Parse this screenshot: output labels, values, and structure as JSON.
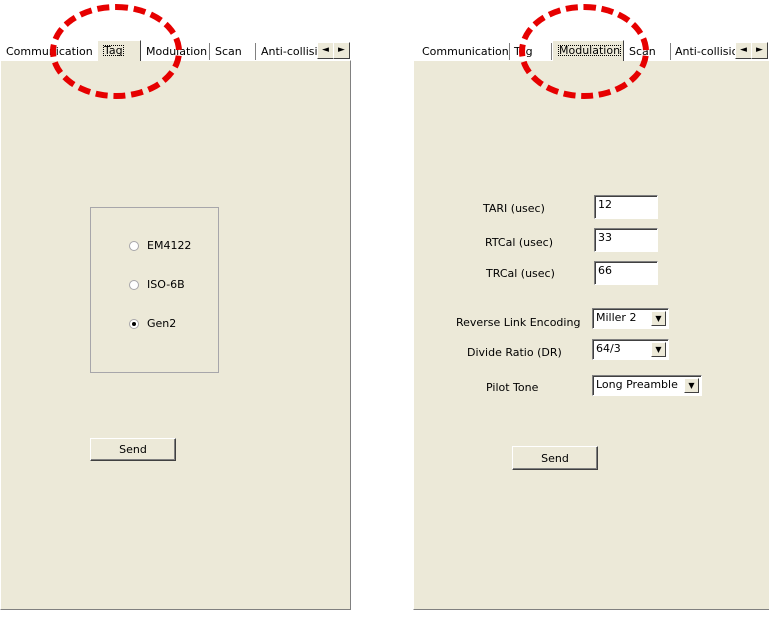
{
  "left": {
    "tabs": [
      "Communication",
      "Tag",
      "Modulation",
      "Scan",
      "Anti-collisio"
    ],
    "active_tab": "Tag",
    "scroll_left": "◄",
    "scroll_right": "►",
    "radios": [
      {
        "label": "EM4122",
        "checked": false
      },
      {
        "label": "ISO-6B",
        "checked": false
      },
      {
        "label": "Gen2",
        "checked": true
      }
    ],
    "send_label": "Send"
  },
  "right": {
    "tabs": [
      "Communication",
      "Tag",
      "Modulation",
      "Scan",
      "Anti-collisio"
    ],
    "active_tab": "Modulation",
    "scroll_left": "◄",
    "scroll_right": "►",
    "fields": [
      {
        "label": "TARI (usec)",
        "value": "12"
      },
      {
        "label": "RTCal (usec)",
        "value": "33"
      },
      {
        "label": "TRCal (usec)",
        "value": "66"
      }
    ],
    "dropdowns": [
      {
        "label": "Reverse Link Encoding",
        "value": "Miller 2"
      },
      {
        "label": "Divide Ratio (DR)",
        "value": "64/3"
      },
      {
        "label": "Pilot Tone",
        "value": "Long Preamble"
      }
    ],
    "dropdown_arrow": "▼",
    "send_label": "Send"
  },
  "colors": {
    "annotation": "#e60000",
    "panel_bg": "#ece9d8"
  }
}
